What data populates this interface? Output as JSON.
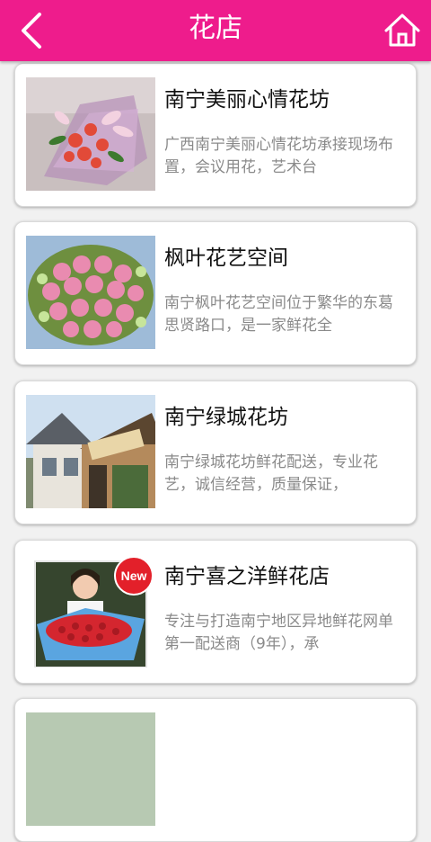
{
  "header": {
    "title": "花店",
    "back_icon": "chevron-left-icon",
    "home_icon": "home-icon",
    "color": "#ee1c8c"
  },
  "shops": [
    {
      "name": "南宁美丽心情花坊",
      "desc": "广西南宁美丽心情花坊承接现场布置，会议用花，艺术台",
      "image": "pink-lily-bouquet"
    },
    {
      "name": "枫叶花艺空间",
      "desc": "南宁枫叶花艺空间位于繁华的东葛思贤路口，是一家鲜花全",
      "image": "pink-rose-basket"
    },
    {
      "name": "南宁绿城花坊",
      "desc": "南宁绿城花坊鲜花配送，专业花艺，诚信经营，质量保证，",
      "image": "flower-shop-storefront"
    },
    {
      "name": "南宁喜之洋鲜花店",
      "desc": "专注与打造南宁地区异地鲜花网单第一配送商（9年），承",
      "image": "woman-with-red-roses",
      "badge": "New"
    }
  ]
}
